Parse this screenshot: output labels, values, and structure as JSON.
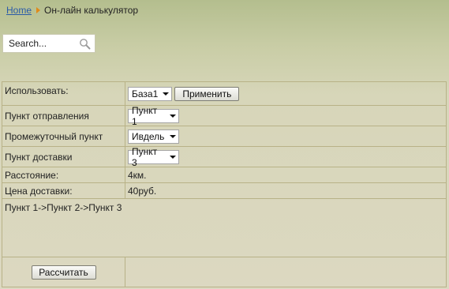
{
  "breadcrumb": {
    "home": "Home",
    "current": "Он-лайн калькулятор"
  },
  "search": {
    "value": "Search..."
  },
  "form": {
    "use": {
      "label": "Использовать:",
      "select_value": "База1",
      "apply_button": "Применить"
    },
    "departure": {
      "label": "Пункт отправления",
      "select_value": "Пункт 1"
    },
    "intermediate": {
      "label": "Промежуточный пункт",
      "select_value": "Ивдель"
    },
    "delivery": {
      "label": "Пункт доставки",
      "select_value": "Пункт 3"
    },
    "distance": {
      "label": "Расстояние:",
      "value": "4км."
    },
    "price": {
      "label": "Цена доставки:",
      "value": "40руб."
    },
    "route": "Пункт 1->Пункт 2->Пункт 3",
    "calculate_button": "Рассчитать"
  }
}
